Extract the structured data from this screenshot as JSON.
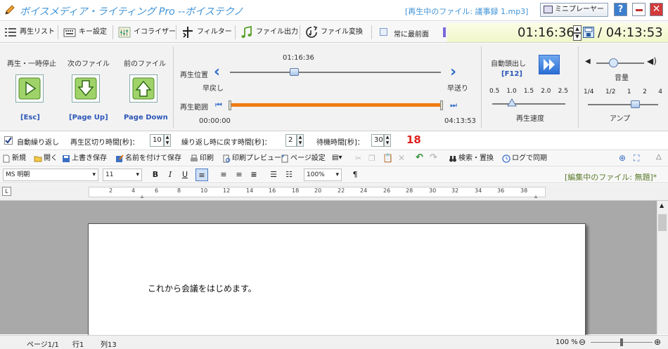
{
  "window": {
    "title": "ボイスメディア・ライティング Pro --ボイステクノ",
    "playing_file": "[再生中のファイル: 議事録 1.mp3]",
    "mini_player_label": "ミニプレーヤー",
    "help_label": "?",
    "close_label": "✕"
  },
  "toolbar": {
    "items": [
      {
        "label": "再生リスト",
        "icon": "playlist-icon"
      },
      {
        "label": "キー設定",
        "icon": "keyboard-icon"
      },
      {
        "label": "イコライザー",
        "icon": "equalizer-icon"
      },
      {
        "label": "フィルター",
        "icon": "filter-icon"
      },
      {
        "label": "ファイル出力",
        "icon": "music-note-icon"
      },
      {
        "label": "ファイル変換",
        "icon": "convert-icon"
      }
    ],
    "always_on_top_label": "常に最前面",
    "always_on_top_checked": false,
    "current_time": "01:16:36",
    "total_time": "/ 04:13:53"
  },
  "controls": {
    "play_pause_label": "再生・一時停止",
    "next_file_label": "次のファイル",
    "prev_file_label": "前のファイル",
    "play_key": "[Esc]",
    "next_key": "[Page Up]",
    "prev_key": "Page Down",
    "position_label": "再生位置",
    "position_time": "01:16:36",
    "position_fraction": 0.302,
    "rewind_label": "早戻し",
    "forward_label": "早送り",
    "range_label": "再生範囲",
    "range_start": "00:00:00",
    "range_end": "04:13:53",
    "auto_head_label": "自動頭出し",
    "auto_head_key": "[F12]",
    "speed_ticks": [
      "0.5",
      "1.0",
      "1.5",
      "2.0",
      "2.5"
    ],
    "speed_label": "再生速度",
    "speed_value": "1.0",
    "volume_label": "音量",
    "volume_fraction": 0.36,
    "amp_ticks": [
      "1/4",
      "1/2",
      "1",
      "2",
      "4"
    ],
    "amp_label": "アンプ",
    "amp_value": "2"
  },
  "options": {
    "auto_repeat_label": "自動繰り返し",
    "auto_repeat_checked": true,
    "segment_label": "再生区切り時間[秒]：",
    "segment_value": "10",
    "rewind_back_label": "繰り返し時に戻す時間[秒]：",
    "rewind_back_value": "2",
    "wait_label": "待機時間[秒]：",
    "wait_value": "30",
    "counter": "18"
  },
  "editor_toolbar": {
    "items": [
      {
        "label": "新規",
        "icon": "new-file-icon"
      },
      {
        "label": "開く",
        "icon": "open-folder-icon"
      },
      {
        "label": "上書き保存",
        "icon": "save-icon"
      },
      {
        "label": "名前を付けて保存",
        "icon": "save-as-icon"
      },
      {
        "label": "印刷",
        "icon": "print-icon"
      },
      {
        "label": "印刷プレビュー",
        "icon": "print-preview-icon"
      },
      {
        "label": "ページ設定",
        "icon": "page-setup-icon"
      },
      {
        "label": "検索・置換",
        "icon": "binoculars-icon"
      },
      {
        "label": "ログで同期",
        "icon": "clock-icon"
      }
    ]
  },
  "format_bar": {
    "font_name": "MS 明朝",
    "font_size": "11",
    "bold": "B",
    "italic": "I",
    "underline": "U",
    "zoom": "100%",
    "pilcrow": "¶",
    "editing_file": "[編集中のファイル: 無題]*"
  },
  "ruler": {
    "corner": "L",
    "numbers": [
      "2",
      "4",
      "6",
      "8",
      "10",
      "12",
      "14",
      "16",
      "18",
      "20",
      "22",
      "24",
      "26",
      "28",
      "30",
      "32",
      "34",
      "36",
      "38"
    ]
  },
  "document": {
    "text": "これから会議をはじめます。"
  },
  "status": {
    "page": "ページ1/1",
    "line": "行1",
    "column": "列13",
    "zoom": "100 %"
  }
}
